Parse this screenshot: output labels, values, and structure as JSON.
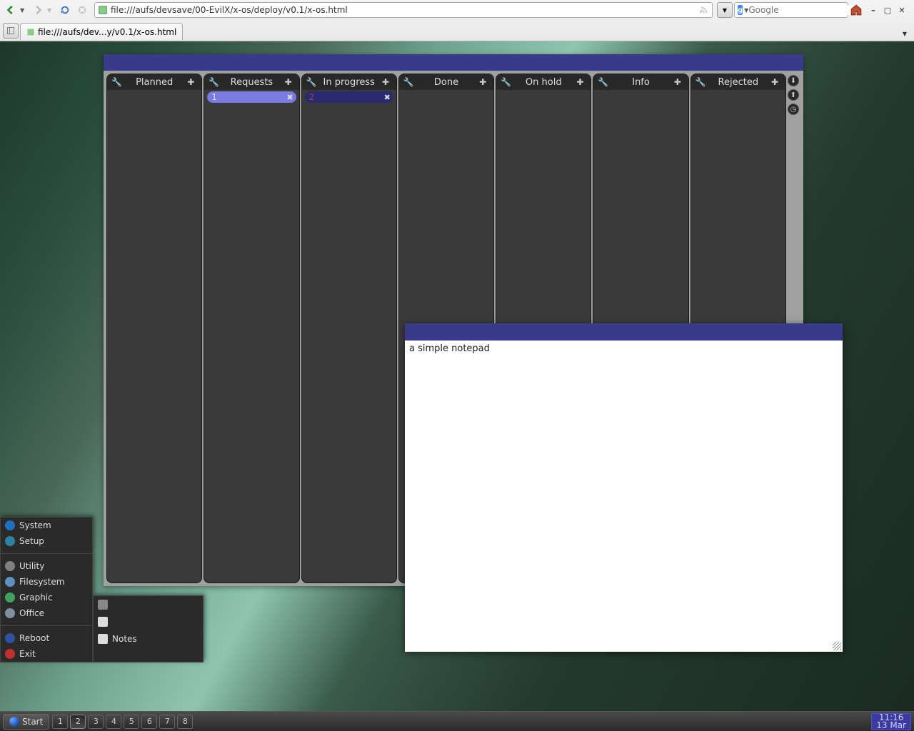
{
  "browser": {
    "url": "file:///aufs/devsave/00-EvilX/x-os/deploy/v0.1/x-os.html",
    "tab_title": "file:///aufs/dev...y/v0.1/x-os.html",
    "search_placeholder": "Google"
  },
  "kanban": {
    "columns": [
      {
        "title": "Planned"
      },
      {
        "title": "Requests"
      },
      {
        "title": "In progress"
      },
      {
        "title": "Done"
      },
      {
        "title": "On hold"
      },
      {
        "title": "Info"
      },
      {
        "title": "Rejected"
      }
    ],
    "cards": {
      "requests": {
        "label": "1"
      },
      "inprogress": {
        "label": "2"
      }
    }
  },
  "notepad": {
    "content": "a simple notepad"
  },
  "start_menu": {
    "items": [
      {
        "label": "System",
        "icon_bg": "#2070c0"
      },
      {
        "label": "Setup",
        "icon_bg": "#3080a0"
      },
      {
        "label": "Utility",
        "icon_bg": "#808080"
      },
      {
        "label": "Filesystem",
        "icon_bg": "#6090c0"
      },
      {
        "label": "Graphic",
        "icon_bg": "#40a060"
      },
      {
        "label": "Office",
        "icon_bg": "#8090a0"
      },
      {
        "label": "Reboot",
        "icon_bg": "#3050a0"
      },
      {
        "label": "Exit",
        "icon_bg": "#c03030"
      }
    ]
  },
  "submenu": {
    "items": [
      {
        "label": "",
        "icon_bg": "#888"
      },
      {
        "label": "",
        "icon_bg": "#ddd"
      },
      {
        "label": "Notes",
        "icon_bg": "#ddd"
      }
    ]
  },
  "taskbar": {
    "start_label": "Start",
    "workspaces": [
      "1",
      "2",
      "3",
      "4",
      "5",
      "6",
      "7",
      "8"
    ],
    "active_ws": 1,
    "clock_time": "11:16",
    "clock_date": "13 Mar"
  }
}
